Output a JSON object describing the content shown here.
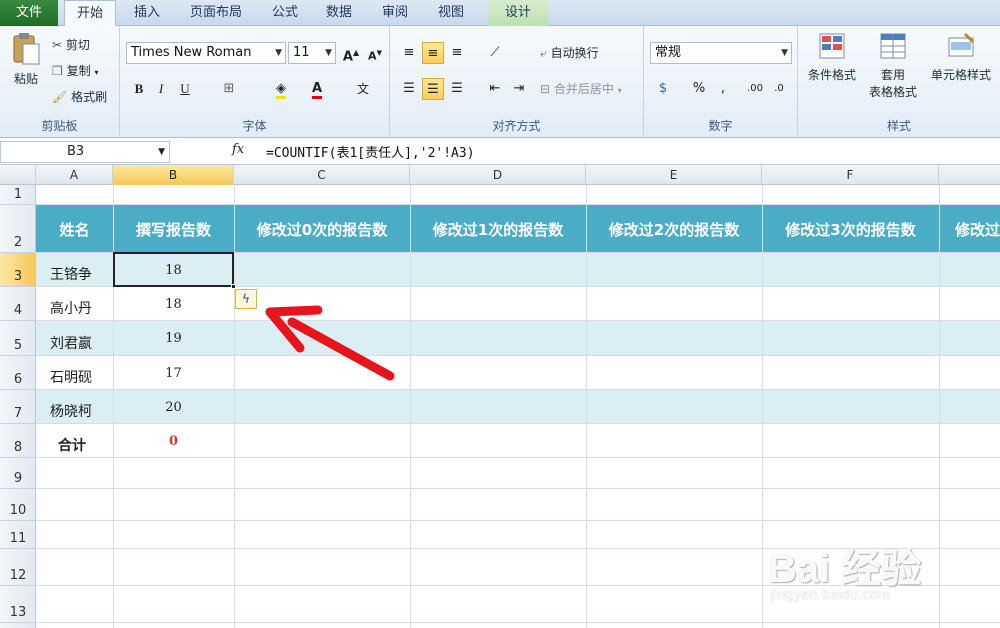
{
  "tabs": {
    "file": "文件",
    "home": "开始",
    "insert": "插入",
    "page_layout": "页面布局",
    "formulas": "公式",
    "data": "数据",
    "review": "审阅",
    "view": "视图",
    "design": "设计"
  },
  "ribbon": {
    "clipboard": {
      "paste": "粘贴",
      "cut": "剪切",
      "copy": "复制",
      "format_painter": "格式刷",
      "label": "剪贴板"
    },
    "font": {
      "name": "Times New Roman",
      "size": "11",
      "label": "字体"
    },
    "alignment": {
      "wrap_text": "自动换行",
      "merge_center": "合并后居中",
      "label": "对齐方式"
    },
    "number": {
      "format": "常规",
      "label": "数字"
    },
    "styles": {
      "conditional_format": "条件格式",
      "table_format_line1": "套用",
      "table_format_line2": "表格格式",
      "cell_styles": "单元格样式",
      "label": "样式"
    }
  },
  "formula_bar": {
    "name_box": "B3",
    "fx": "fx",
    "formula": "=COUNTIF(表1[责任人],'2'!A3)"
  },
  "columns": [
    "A",
    "B",
    "C",
    "D",
    "E",
    "F"
  ],
  "rows": [
    "1",
    "2",
    "3",
    "4",
    "5",
    "6",
    "7",
    "8",
    "9",
    "10",
    "11",
    "12",
    "13"
  ],
  "table": {
    "headers": [
      "姓名",
      "撰写报告数",
      "修改过0次的报告数",
      "修改过1次的报告数",
      "修改过2次的报告数",
      "修改过3次的报告数",
      "修改过"
    ],
    "data": [
      {
        "name": "王铬争",
        "count": "18"
      },
      {
        "name": "高小丹",
        "count": "18"
      },
      {
        "name": "刘君嬴",
        "count": "19"
      },
      {
        "name": "石明砚",
        "count": "17"
      },
      {
        "name": "杨晓柯",
        "count": "20"
      }
    ],
    "total_label": "合计",
    "total_value": "0"
  },
  "watermark": {
    "brand": "Bai 经验",
    "url": "jingyan.baidu.com"
  },
  "colors": {
    "header_fill": "#4bacc6",
    "band_fill": "#dbeef4",
    "arrow": "#e8141c",
    "total_value": "#c0392b"
  }
}
